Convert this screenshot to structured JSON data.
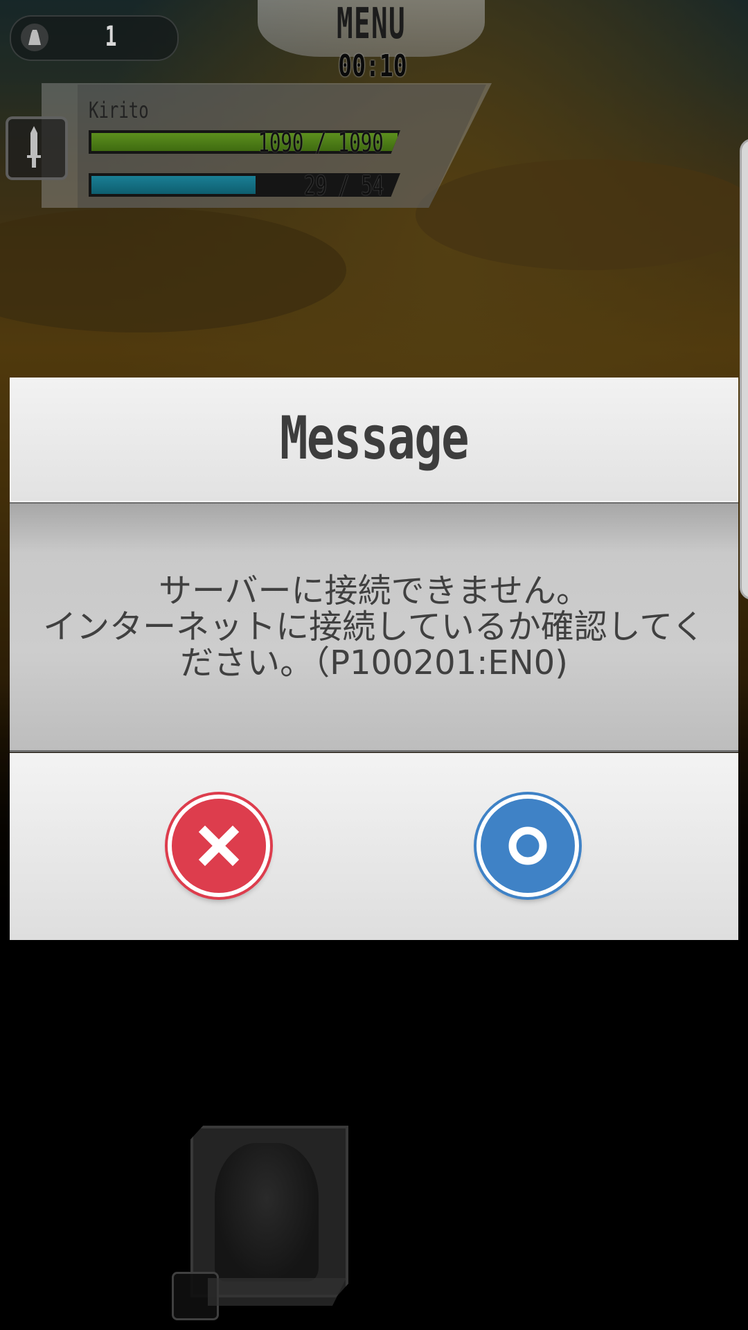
{
  "hud": {
    "bag_count": "1",
    "menu_label": "MENU",
    "timer": "00:10"
  },
  "character": {
    "name": "Kirito",
    "hp_text": "1090 / 1090",
    "hp_fraction": 1.0,
    "mp_text": "29 / 54",
    "mp_fraction": 0.537
  },
  "dialog": {
    "title": "Message",
    "message": "サーバーに接続できません。\nインターネットに接続しているか確認してく\nださい。（P100201:EN0)",
    "cancel_icon": "x-icon",
    "confirm_icon": "circle-o-icon"
  },
  "colors": {
    "cancel": "#dd3d4d",
    "confirm": "#3f82c6",
    "hp": "#5c8f1e",
    "mp": "#1a7f95"
  }
}
